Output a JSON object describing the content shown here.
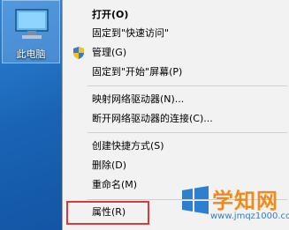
{
  "desktop": {
    "icon_label": "此电脑"
  },
  "context_menu": {
    "items": [
      {
        "label": "打开(O)"
      },
      {
        "label": "固定到\"快速访问\""
      },
      {
        "label": "管理(G)"
      },
      {
        "label": "固定到\"开始\"屏幕(P)"
      },
      {
        "label": "映射网络驱动器(N)..."
      },
      {
        "label": "断开网络驱动器的连接(C)..."
      },
      {
        "label": "创建快捷方式(S)"
      },
      {
        "label": "删除(D)"
      },
      {
        "label": "重命名(M)"
      },
      {
        "label": "属性(R)"
      }
    ],
    "highlighted_item": "属性(R)"
  },
  "watermark": {
    "title": "学知网",
    "url": "www.jmqz1000.com"
  },
  "colors": {
    "highlight_border": "#d93a3a",
    "watermark_orange": "#f28a1a",
    "watermark_blue": "#2d7fd0"
  }
}
